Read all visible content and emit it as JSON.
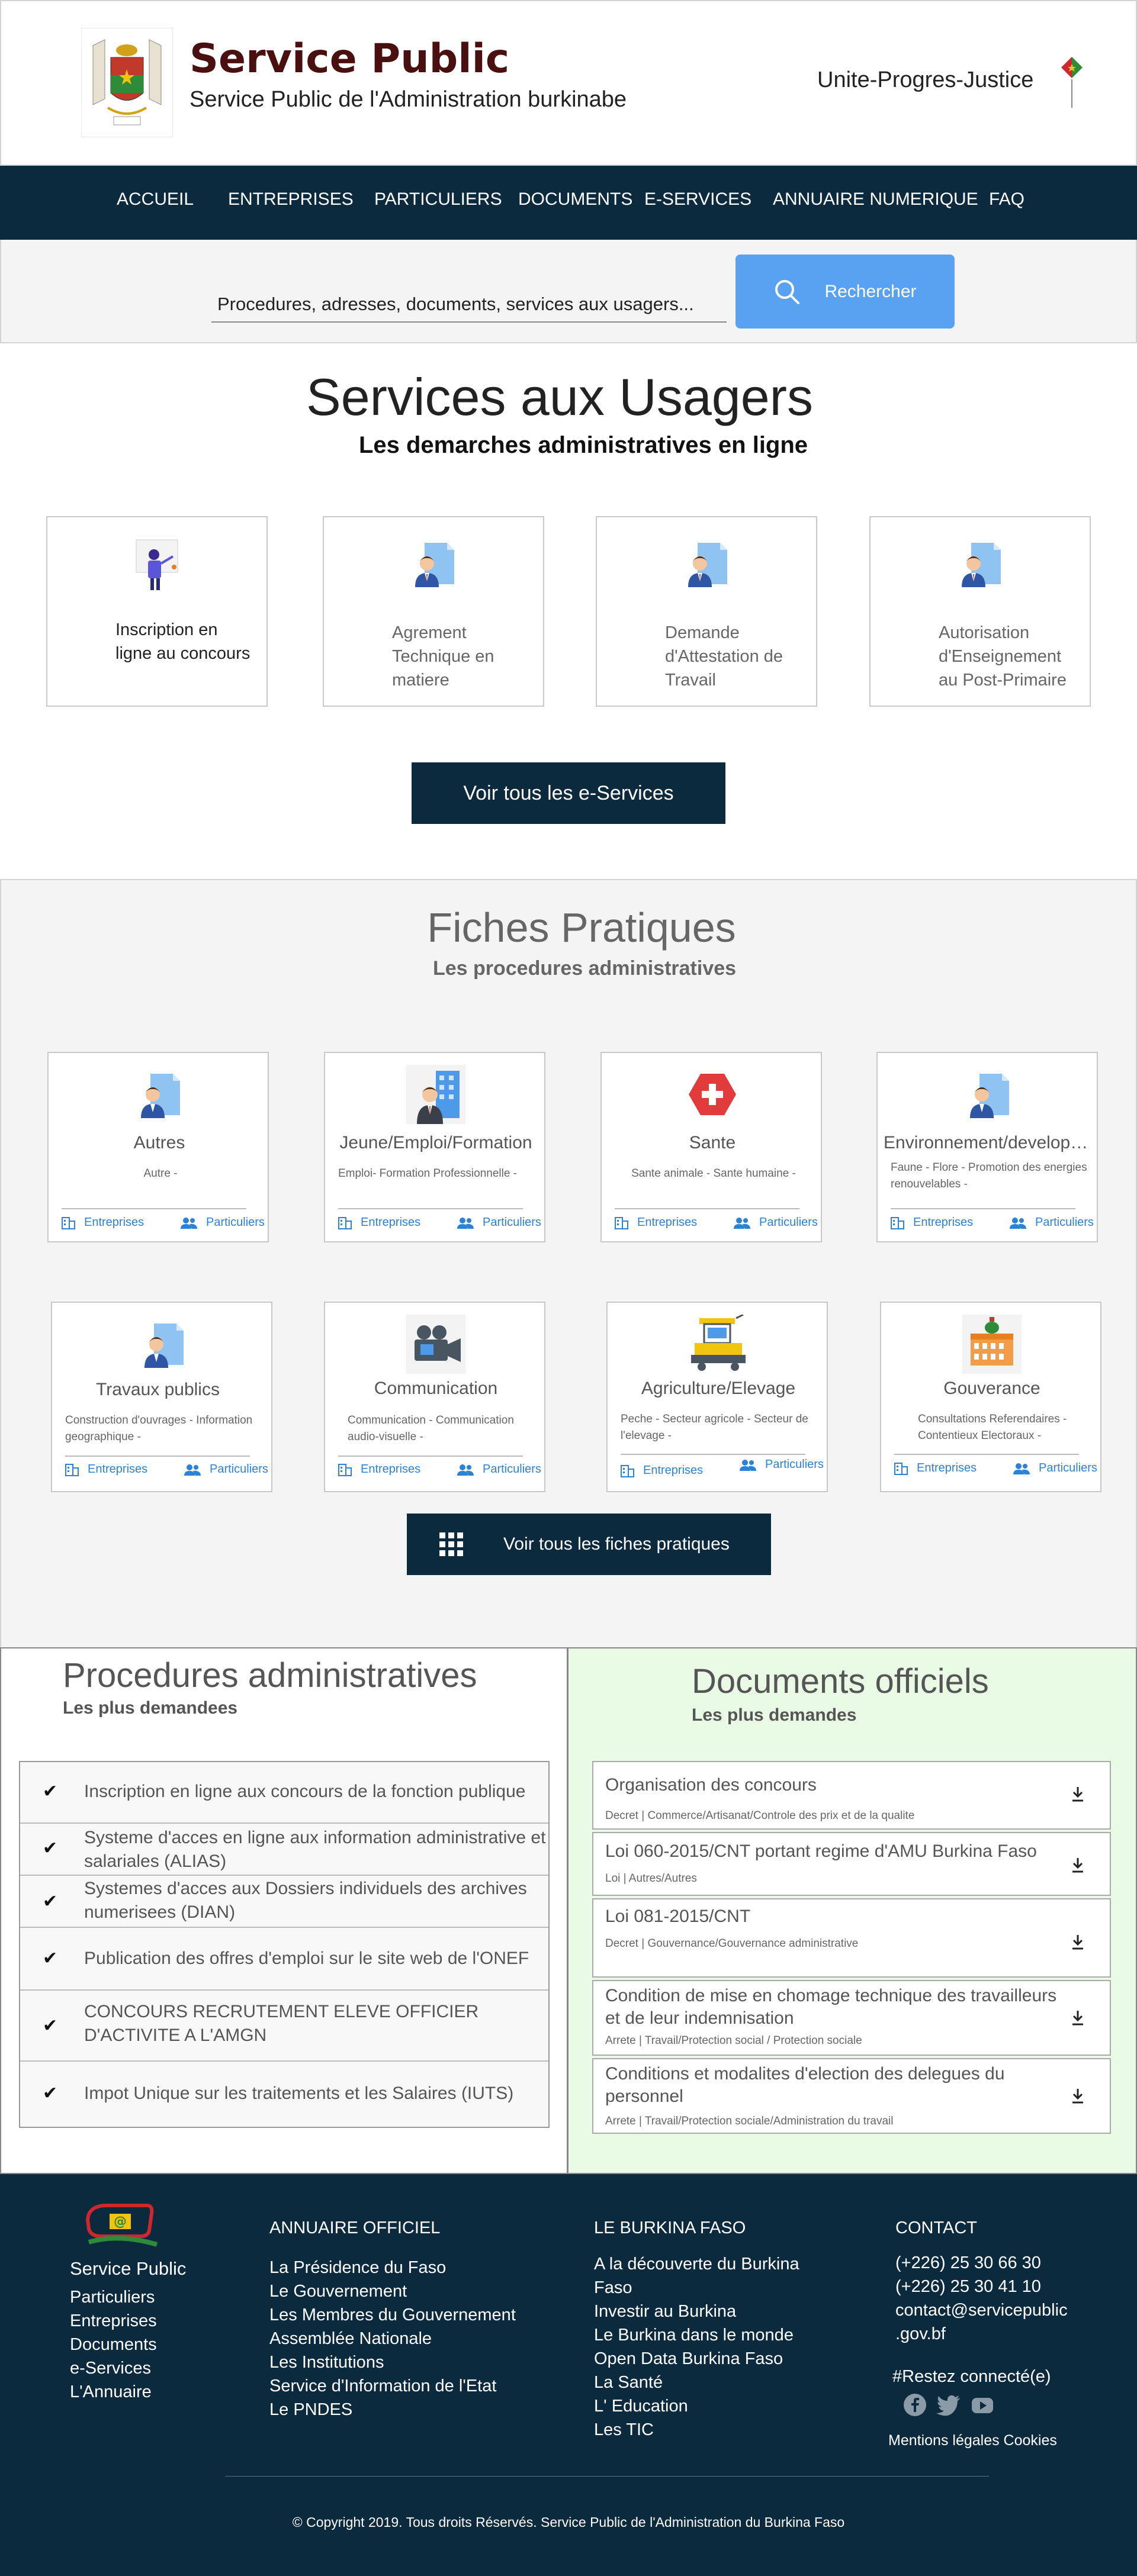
{
  "header": {
    "title": "Service Public",
    "subtitle": "Service Public de l'Administration burkinabe",
    "motto": "Unite-Progres-Justice"
  },
  "nav": {
    "items": [
      "ACCUEIL",
      "ENTREPRISES",
      "PARTICULIERS",
      "DOCUMENTS",
      "E-SERVICES",
      "ANNUAIRE NUMERIQUE",
      "FAQ"
    ]
  },
  "search": {
    "placeholder": "Procedures, adresses, documents, services aux usagers...",
    "button": "Rechercher"
  },
  "services": {
    "title": "Services aux Usagers",
    "subtitle": "Les demarches administratives en ligne",
    "cards": [
      {
        "label": "Inscription en ligne au concours",
        "icon": "presenter-icon"
      },
      {
        "label": "Agrement Technique en matiere",
        "icon": "person-document-icon"
      },
      {
        "label": "Demande d'Attestation de Travail",
        "icon": "person-document-icon"
      },
      {
        "label": "Autorisation d'Enseignement au Post-Primaire",
        "icon": "person-document-icon"
      }
    ],
    "button": "Voir tous les e-Services"
  },
  "fiches": {
    "title": "Fiches Pratiques",
    "subtitle": "Les procedures administratives",
    "link_entreprises": "Entreprises",
    "link_particuliers": "Particuliers",
    "cards": [
      {
        "name": "Autres",
        "tags": "Autre -",
        "icon": "person-document-icon"
      },
      {
        "name": "Jeune/Emploi/Formation",
        "tags": "Emploi- Formation Professionnelle -",
        "icon": "office-worker-icon"
      },
      {
        "name": "Sante",
        "tags": "Sante animale - Sante humaine -",
        "icon": "medical-cross-icon"
      },
      {
        "name": "Environnement/developpement durable",
        "tags": "Faune - Flore - Promotion des energies renouvelables -",
        "icon": "person-document-icon"
      },
      {
        "name": "Travaux publics",
        "tags": "Construction d'ouvrages - Information geographique -",
        "icon": "person-document-icon"
      },
      {
        "name": "Communication",
        "tags": "Communication - Communication audio-visuelle -",
        "icon": "video-camera-icon"
      },
      {
        "name": "Agriculture/Elevage",
        "tags": "Peche - Secteur agricole - Secteur de l'elevage -",
        "icon": "tractor-icon"
      },
      {
        "name": "Gouverance",
        "tags": "Consultations Referendaires - Contentieux Electoraux -",
        "icon": "government-building-icon"
      }
    ],
    "button": "Voir tous les fiches pratiques"
  },
  "procedures": {
    "title": "Procedures administratives",
    "subtitle": "Les plus demandees",
    "items": [
      "Inscription en ligne aux concours de la fonction publique",
      "Systeme d'acces en ligne aux information administrative et salariales (ALIAS)",
      "Systemes d'acces aux Dossiers individuels des archives numerisees (DIAN)",
      "Publication des offres d'emploi sur le site web de l'ONEF",
      "CONCOURS RECRUTEMENT ELEVE OFFICIER D'ACTIVITE A L'AMGN",
      "Impot Unique sur les traitements et les Salaires (IUTS)"
    ]
  },
  "documents": {
    "title": "Documents officiels",
    "subtitle": "Les plus demandes",
    "items": [
      {
        "title": "Organisation des concours",
        "meta": "Decret | Commerce/Artisanat/Controle des prix et de la qualite"
      },
      {
        "title": "Loi 060-2015/CNT portant regime d'AMU Burkina Faso",
        "meta": "Loi | Autres/Autres"
      },
      {
        "title": "Loi 081-2015/CNT",
        "meta": "Decret | Gouvernance/Gouvernance administrative"
      },
      {
        "title": "Condition de mise en chomage technique des travailleurs et de leur indemnisation",
        "meta": "Arrete | Travail/Protection social / Protection sociale"
      },
      {
        "title": "Conditions et modalites d'election des delegues du personnel",
        "meta": "Arrete | Travail/Protection sociale/Administration du travail"
      }
    ]
  },
  "footer": {
    "brand": "Service Public",
    "brand_links": [
      "Particuliers",
      "Entreprises",
      "Documents",
      "e-Services",
      "L'Annuaire"
    ],
    "col1_title": "ANNUAIRE OFFICIEL",
    "col1_links": [
      "La Présidence du Faso",
      "Le Gouvernement",
      "Les Membres du Gouvernement",
      "Assemblée Nationale",
      "Les Institutions",
      "Service d'Information de l'Etat",
      "Le PNDES"
    ],
    "col2_title": "LE BURKINA FASO",
    "col2_links": [
      "A la découverte du Burkina",
      "Faso",
      "Investir au Burkina",
      "Le Burkina dans le monde",
      "Open Data Burkina Faso",
      "La Santé",
      "L' Education",
      "Les TIC"
    ],
    "col3_title": "CONTACT",
    "contact": [
      "(+226) 25 30 66 30",
      "(+226) 25 30 41 10",
      "contact@servicepublic",
      ".gov.bf"
    ],
    "social_label": "#Restez connecté(e)",
    "legal": "Mentions légales Cookies",
    "copyright": "© Copyright 2019. Tous droits Réservés. Service Public de l'Administration du Burkina Faso"
  },
  "colors": {
    "nav_bg": "#0c2a3e",
    "accent_blue": "#58a2f1",
    "brand_title": "#4a0f0f",
    "docs_bg": "#eafbe5",
    "link_blue": "#2d82d6"
  }
}
